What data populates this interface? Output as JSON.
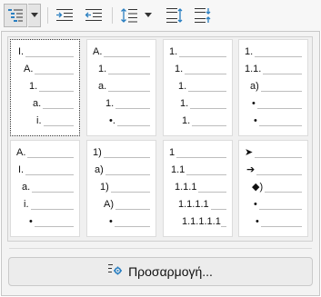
{
  "toolbar": {
    "icons": [
      "outline-format-icon",
      "dropdown-arrow-icon",
      "increase-indent-icon",
      "decrease-indent-icon",
      "line-spacing-icon",
      "dropdown-arrow-icon",
      "increase-paragraph-spacing-icon",
      "decrease-paragraph-spacing-icon"
    ],
    "accent": "#2a7fc1"
  },
  "styles": [
    {
      "name": "outline-style-1",
      "markers": [
        "I.",
        "A.",
        "1.",
        "a.",
        "i."
      ]
    },
    {
      "name": "outline-style-2",
      "markers": [
        "A.",
        "1.",
        "a.",
        "1.",
        "•."
      ]
    },
    {
      "name": "outline-style-3",
      "markers": [
        "1.",
        "1.",
        "1.",
        "1.",
        "1."
      ]
    },
    {
      "name": "outline-style-4",
      "markers": [
        "1.",
        "1.1.",
        "a)",
        "•",
        "•"
      ]
    },
    {
      "name": "outline-style-5",
      "markers": [
        "A.",
        "I.",
        "a.",
        "i.",
        "•"
      ]
    },
    {
      "name": "outline-style-6",
      "markers": [
        "1)",
        "a)",
        "1)",
        "A)",
        "•"
      ]
    },
    {
      "name": "outline-style-7",
      "markers": [
        "1",
        "1.1",
        "1.1.1",
        "1.1.1.1",
        "1.1.1.1.1"
      ]
    },
    {
      "name": "outline-style-8",
      "markers": [
        "➤",
        "➔",
        "◆)",
        "•",
        "•"
      ]
    }
  ],
  "selected_style": 0,
  "customize_button": {
    "label": "Προσαρμογή..."
  }
}
